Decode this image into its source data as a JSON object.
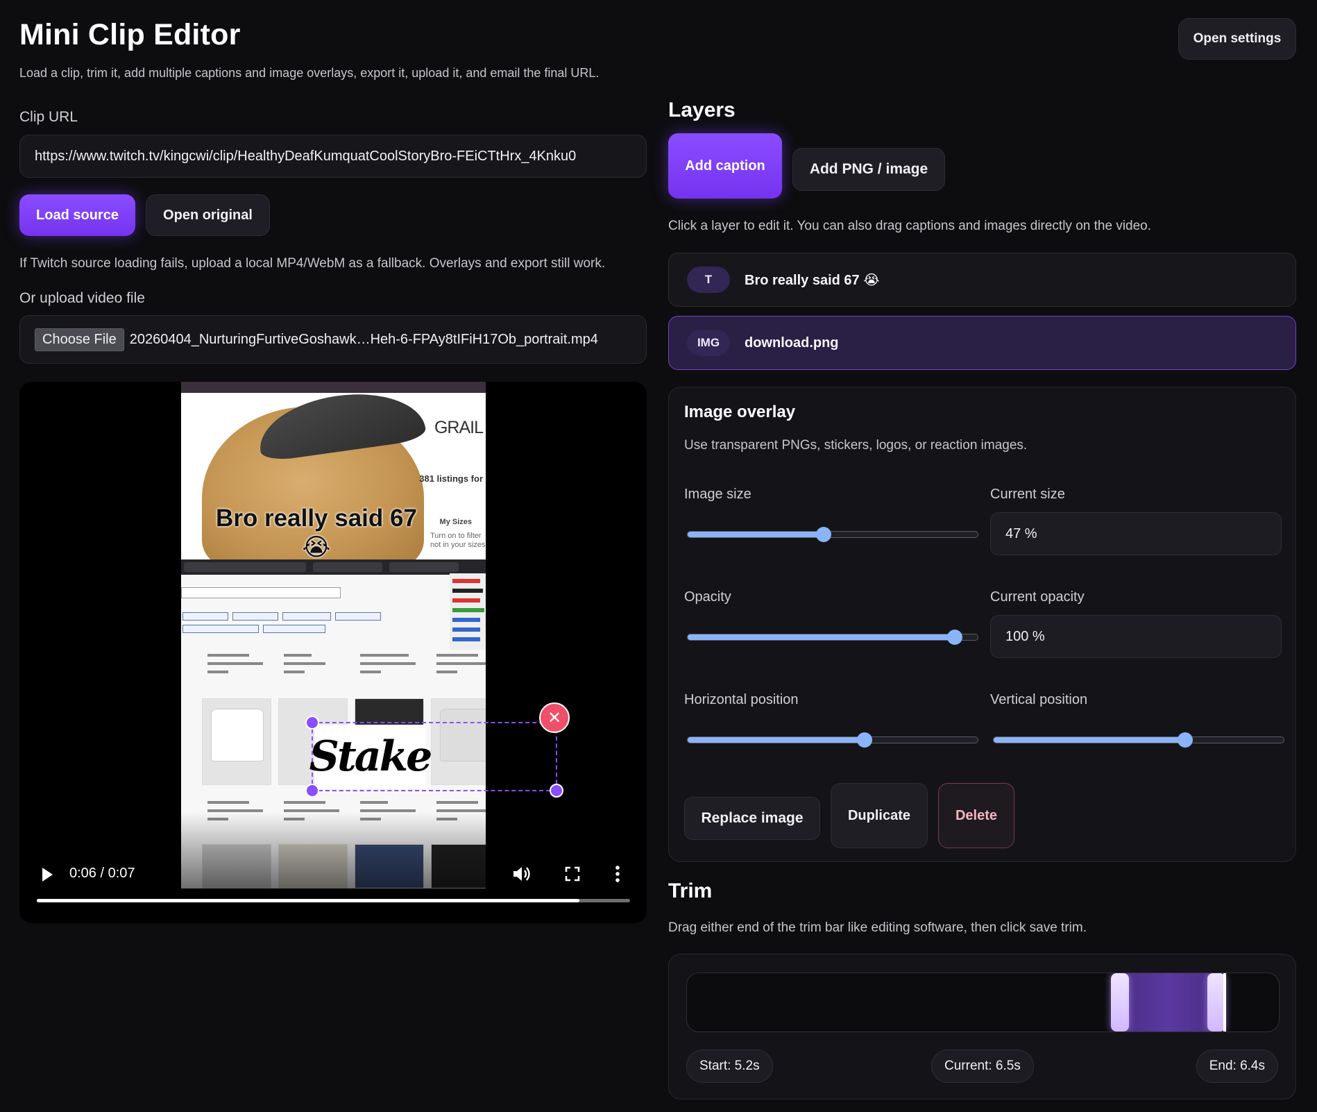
{
  "app": {
    "title": "Mini Clip Editor",
    "subtitle": "Load a clip, trim it, add multiple captions and image overlays, export it, upload it, and email the final URL.",
    "settings_label": "Open settings"
  },
  "source": {
    "clip_url_label": "Clip URL",
    "clip_url_value": "https://www.twitch.tv/kingcwi/clip/HealthyDeafKumquatCoolStoryBro-FEiCTtHrx_4Knku0",
    "load_label": "Load source",
    "open_original_label": "Open original",
    "fallback_text": "If Twitch source loading fails, upload a local MP4/WebM as a fallback. Overlays and export still work.",
    "upload_label": "Or upload video file",
    "choose_file_label": "Choose File",
    "file_name": "20260404_NurturingFurtiveGoshawk…Heh-6-FPAy8tIFiH17Ob_portrait.mp4"
  },
  "video": {
    "caption_text": "Bro really said 67 😭",
    "overlay_logo_text": "Stake",
    "frame_text": {
      "grail": "GRAIL",
      "listings": "381 listings for",
      "my_sizes": "My Sizes",
      "turn_on": "Turn on to filter not in your sizes"
    },
    "time_display": "0:06 / 0:07",
    "progress_fraction": 0.915
  },
  "layers": {
    "title": "Layers",
    "add_caption_label": "Add caption",
    "add_image_label": "Add PNG / image",
    "help_text": "Click a layer to edit it. You can also drag captions and images directly on the video.",
    "items": [
      {
        "tag": "T",
        "name": "Bro really said 67 😭",
        "selected": false
      },
      {
        "tag": "IMG",
        "name": "download.png",
        "selected": true
      }
    ]
  },
  "image_overlay": {
    "title": "Image overlay",
    "subtitle": "Use transparent PNGs, stickers, logos, or reaction images.",
    "size_label": "Image size",
    "current_size_label": "Current size",
    "size_value": 47,
    "size_text": "47 %",
    "opacity_label": "Opacity",
    "current_opacity_label": "Current opacity",
    "opacity_value": 100,
    "opacity_text": "100 %",
    "horizontal_label": "Horizontal position",
    "horizontal_value": 61,
    "vertical_label": "Vertical position",
    "vertical_value": 66,
    "replace_label": "Replace image",
    "duplicate_label": "Duplicate",
    "delete_label": "Delete"
  },
  "trim": {
    "title": "Trim",
    "help_text": "Drag either end of the trim bar like editing software, then click save trim.",
    "duration": 7.0,
    "start": 5.2,
    "current": 6.5,
    "end": 6.4,
    "start_text": "Start: 5.2s",
    "current_text": "Current: 6.5s",
    "end_text": "End: 6.4s"
  },
  "colors": {
    "accent": "#8a4dff",
    "slider": "#8ab4f8",
    "danger": "#ef4f68",
    "background": "#0d0d10"
  }
}
